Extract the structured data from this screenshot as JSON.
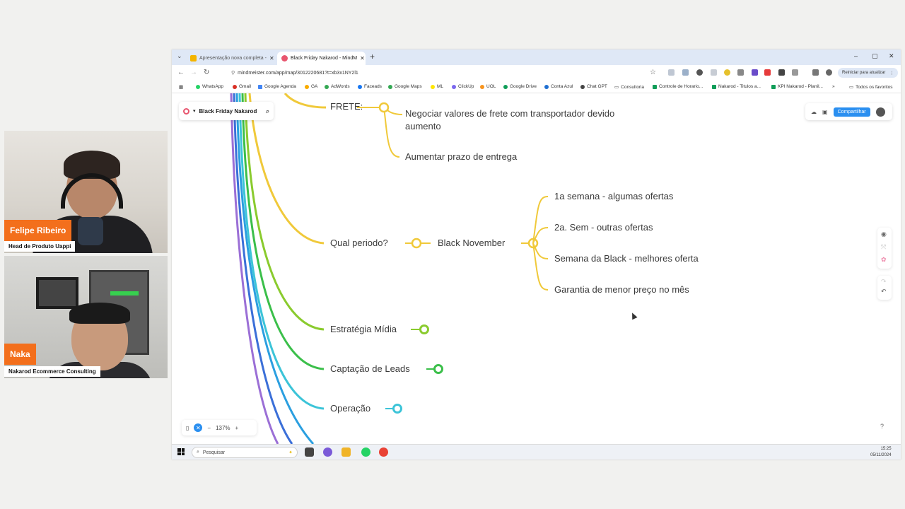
{
  "webcams": [
    {
      "name": "Felipe Ribeiro",
      "role": "Head de Produto Uappi"
    },
    {
      "name": "Naka",
      "role": "Nakarod Ecommerce Consulting"
    }
  ],
  "browser": {
    "tabs": [
      {
        "label": "Apresentação nova completa - ",
        "active": false
      },
      {
        "label": "Black Friday Nakarod - MindM",
        "active": true
      }
    ],
    "url": "mindmeister.com/app/map/3012220681?t=xb3x1NY2l1",
    "restart_label": "Reiniciar para atualizar",
    "bookmarks": [
      "WhatsApp",
      "Gmail",
      "Google Agenda",
      "GA",
      "AdWords",
      "Faceads",
      "Google Maps",
      "ML",
      "ClickUp",
      "UOL",
      "Google Drive",
      "Conta Azul",
      "Chat GPT",
      "Consultoria",
      "Controle de Horario...",
      "Nakarod - Titulos a...",
      "KPI Nakarod - Planil..."
    ],
    "all_favorites": "Todos os favoritos"
  },
  "mindmap": {
    "map_title": "Black Friday Nakarod",
    "share_label": "Compartilhar",
    "zoom": "137%",
    "nodes": {
      "frete": "FRETE:",
      "frete_child1": "Negociar valores de frete com transportador devido aumento",
      "frete_child2": "Aumentar prazo de entrega",
      "periodo": "Qual periodo?",
      "black_november": "Black November",
      "bn_child1": "1a semana - algumas ofertas",
      "bn_child2": "2a. Sem - outras ofertas",
      "bn_child3": "Semana da Black - melhores oferta",
      "bn_child4": "Garantia de menor preço no mês",
      "estrategia": "Estratégia Mídia",
      "captacao": "Captação de Leads",
      "operacao": "Operação"
    }
  },
  "taskbar": {
    "search_placeholder": "Pesquisar",
    "time": "15:25",
    "date": "05/11/2024"
  }
}
